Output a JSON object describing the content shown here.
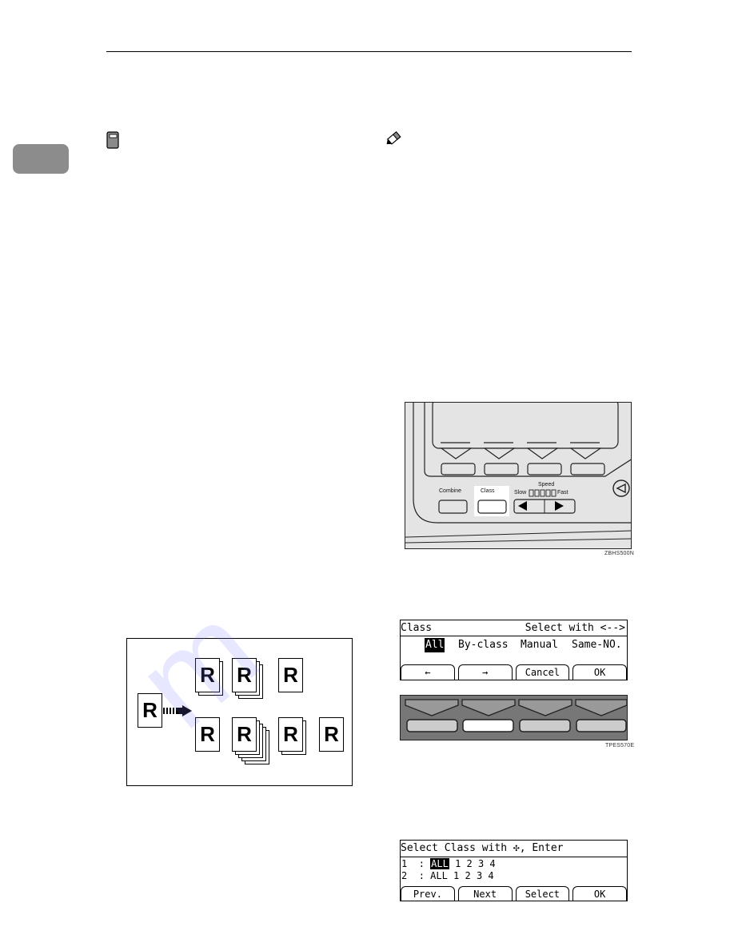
{
  "page": {
    "icons": {
      "important": "book-icon",
      "note": "pencil-icon"
    }
  },
  "panel_figure": {
    "labels": {
      "combine": "Combine",
      "class": "Class",
      "speed": "Speed",
      "slow": "Slow",
      "fast": "Fast"
    },
    "speed_level_boxes": 5,
    "code": "ZBHS500N"
  },
  "class_screen": {
    "title": "Class",
    "hint": "Select with <-->",
    "options": [
      "All",
      "By-class",
      "Manual",
      "Same-NO."
    ],
    "selected_option": "All",
    "softkeys": [
      "←",
      "→",
      "Cancel",
      "OK"
    ],
    "selected_key_index": 1,
    "code": "TPES570E"
  },
  "select_class_screen": {
    "title": "Select Class with ✣, Enter",
    "rows": [
      {
        "num": "1",
        "sep": ":",
        "highlight": "ALL",
        "rest": " 1 2 3 4"
      },
      {
        "num": "2",
        "sep": ":",
        "highlight": "",
        "rest": "ALL 1 2 3 4"
      }
    ],
    "softkeys": [
      "Prev.",
      "Next",
      "Select",
      "OK"
    ]
  },
  "sort_diagram": {
    "original_letter": "R",
    "row1_stack_sizes": [
      2,
      3,
      1
    ],
    "row2_stack_sizes": [
      1,
      5,
      2,
      1
    ]
  }
}
